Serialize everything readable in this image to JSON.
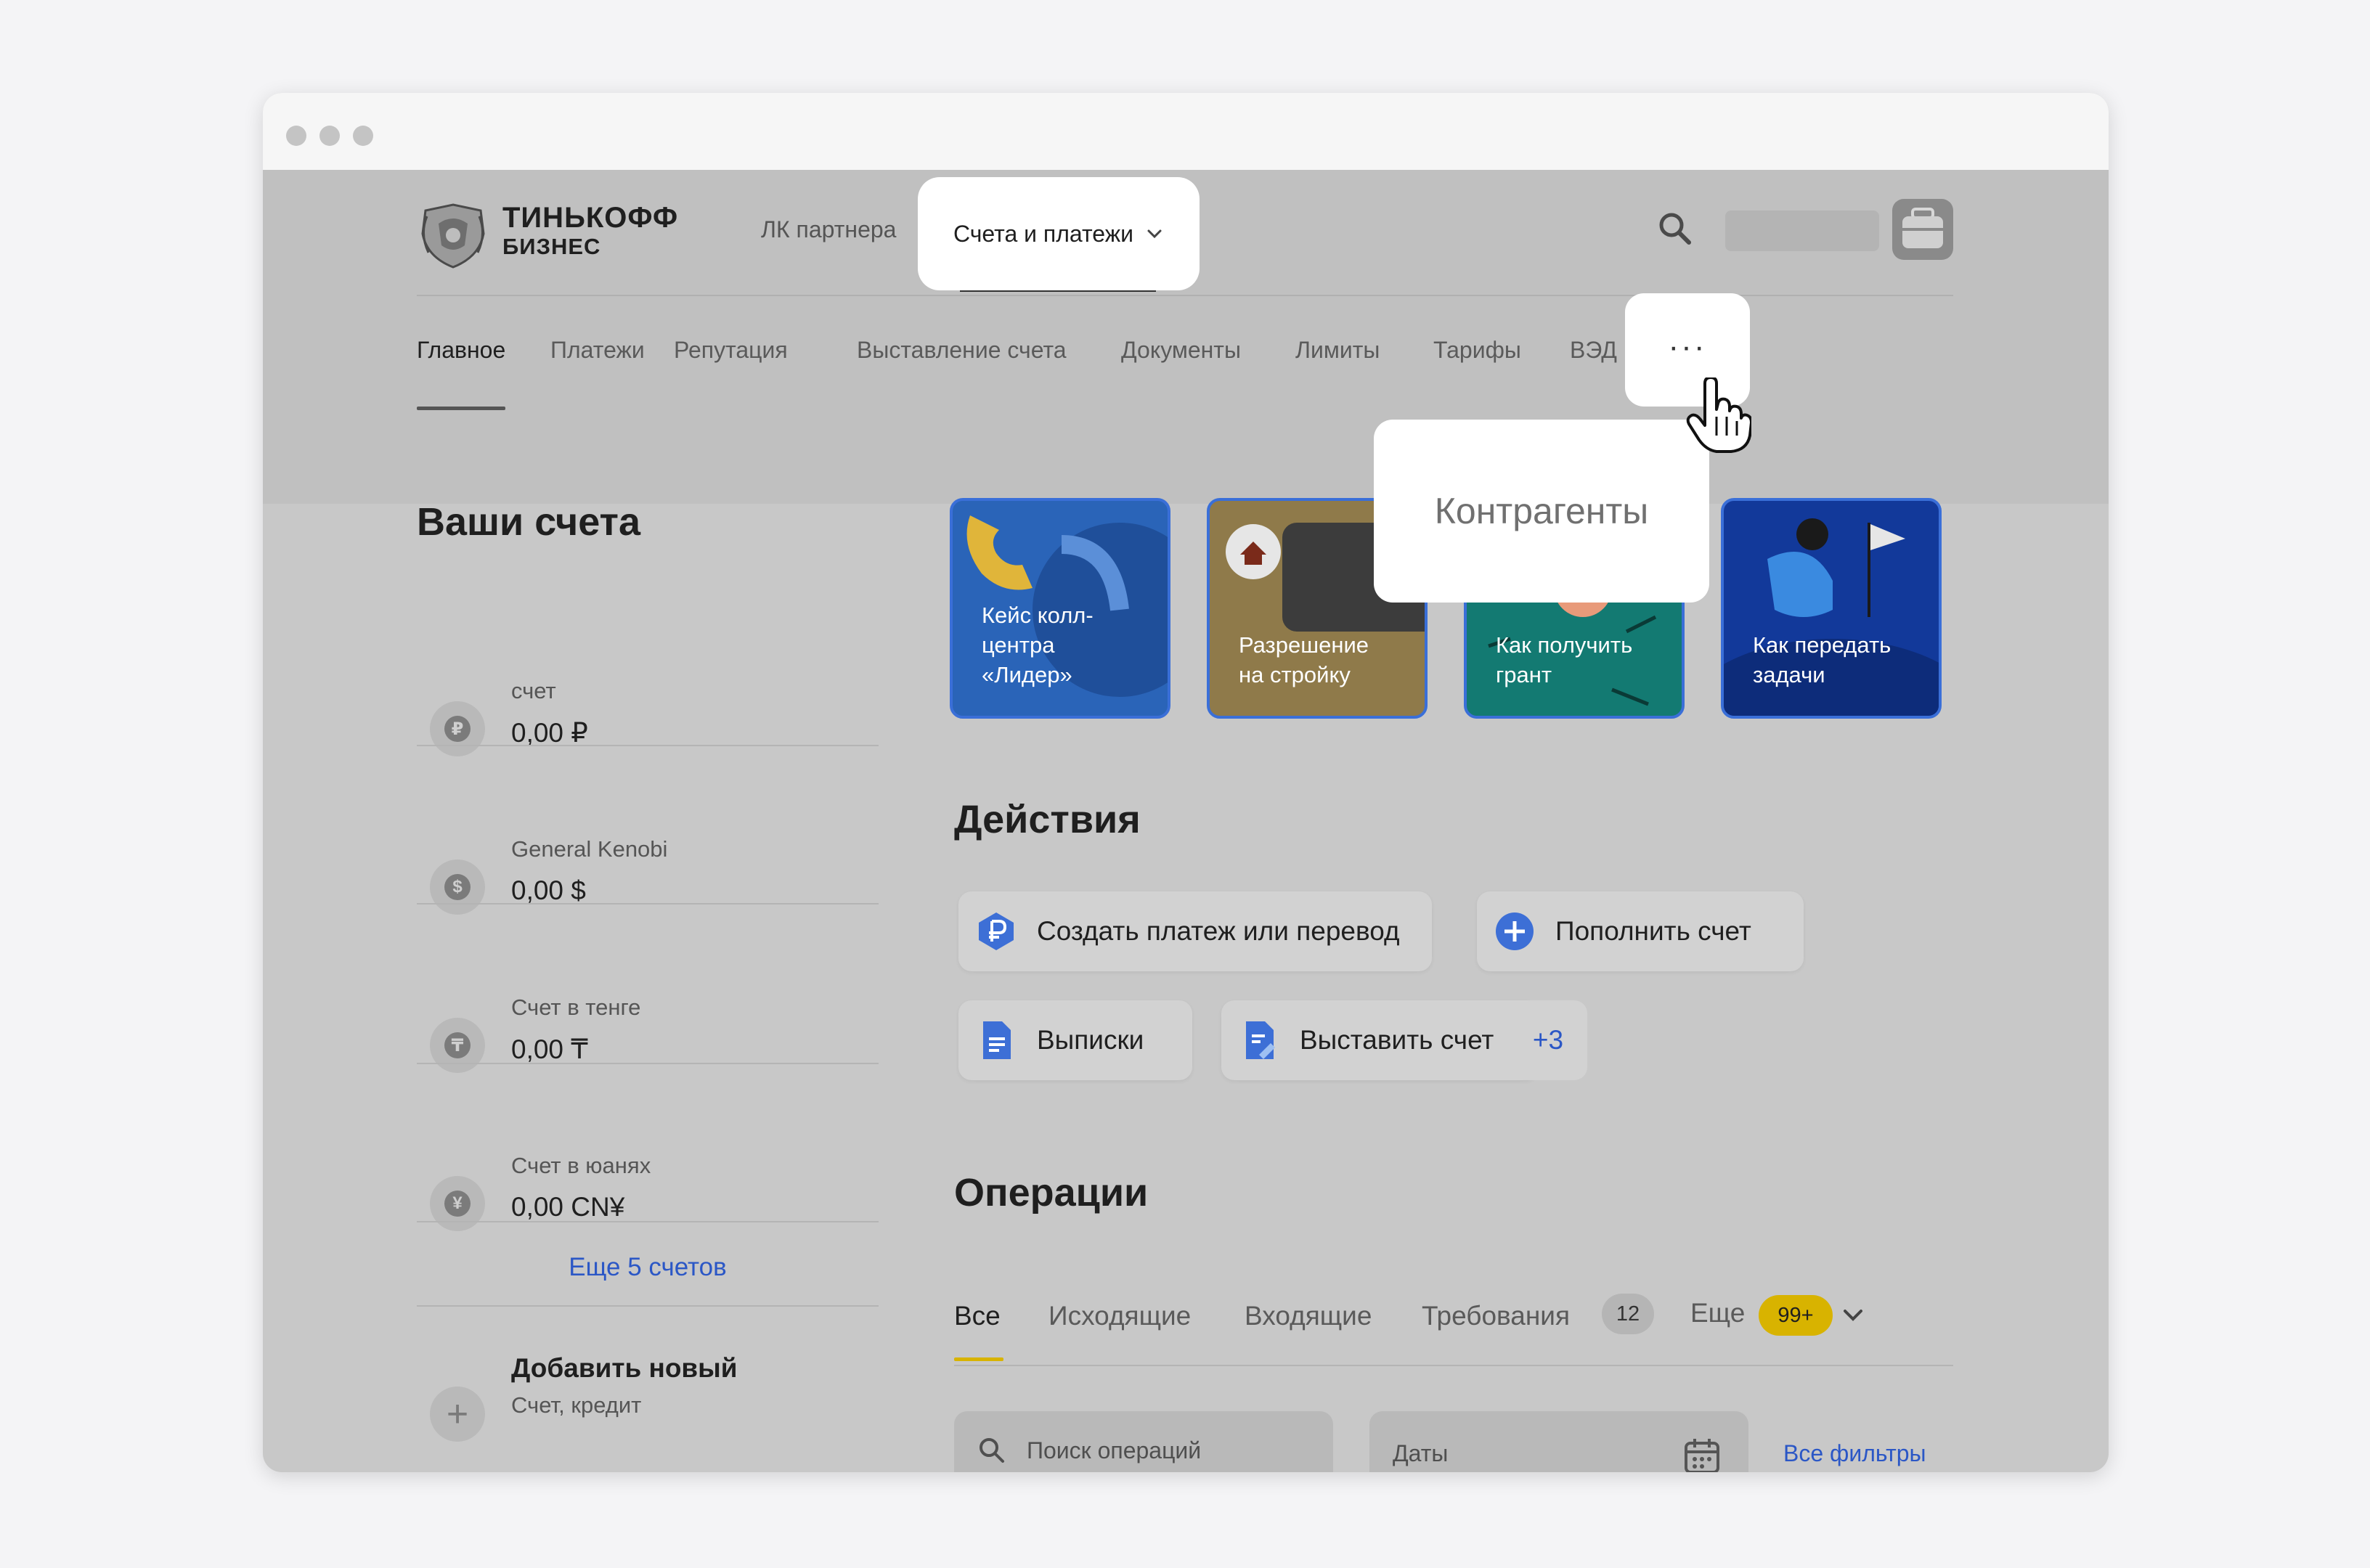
{
  "header": {
    "logo_line1": "ТИНЬКОФФ",
    "logo_line2": "БИЗНЕС",
    "partner_link": "ЛК партнера",
    "accounts_menu": "Счета и платежи"
  },
  "nav": {
    "tabs": [
      {
        "label": "Главное"
      },
      {
        "label": "Платежи"
      },
      {
        "label": "Репутация"
      },
      {
        "label": "Выставление счета"
      },
      {
        "label": "Документы"
      },
      {
        "label": "Лимиты"
      },
      {
        "label": "Тарифы"
      },
      {
        "label": "ВЭД"
      }
    ],
    "more_label": "···",
    "more_popup_item": "Контрагенты"
  },
  "accounts": {
    "title": "Ваши счета",
    "items": [
      {
        "name": "счет",
        "balance": "0,00 ₽",
        "icon": "ruble-icon",
        "glyph": "₽"
      },
      {
        "name": "General Kenobi",
        "balance": "0,00 $",
        "icon": "dollar-icon",
        "glyph": "$"
      },
      {
        "name": "Счет в тенге",
        "balance": "0,00 ₸",
        "icon": "tenge-icon",
        "glyph": "₸"
      },
      {
        "name": "Счет в юанях",
        "balance": "0,00 CN¥",
        "icon": "yuan-icon",
        "glyph": "¥"
      }
    ],
    "more_link": "Еще 5 счетов",
    "add_title": "Добавить новый",
    "add_subtitle": "Счет, кредит"
  },
  "stories": [
    {
      "label": "Кейс колл-\nцентра\n«Лидер»",
      "bg": "#2a64b8"
    },
    {
      "label": "Разрешение\nна стройку",
      "bg": "#8f7a4a"
    },
    {
      "label": "Как получить\nгрант",
      "bg": "#137a72"
    },
    {
      "label": "Как передать\nзадачи",
      "bg": "#12399a"
    }
  ],
  "actions": {
    "title": "Действия",
    "create_payment": "Создать платеж или перевод",
    "top_up": "Пополнить счет",
    "statements": "Выписки",
    "issue_invoice": "Выставить счет",
    "more": "+3"
  },
  "operations": {
    "title": "Операции",
    "tabs": {
      "all": "Все",
      "outgoing": "Исходящие",
      "incoming": "Входящие",
      "requests": "Требования",
      "more": "Еще"
    },
    "requests_count": "12",
    "more_count": "99+",
    "search_placeholder": "Поиск операций",
    "dates_placeholder": "Даты",
    "all_filters": "Все фильтры"
  },
  "colors": {
    "link_blue": "#2b57c6",
    "accent_yellow": "#d8b300",
    "story_border": "#3a6fd8"
  }
}
